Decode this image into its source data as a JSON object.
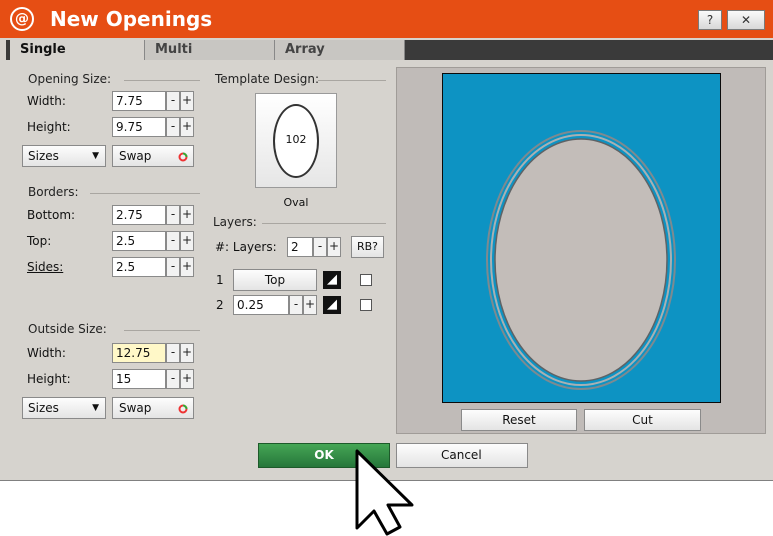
{
  "window": {
    "title": "New Openings",
    "logo_text": "@",
    "help_label": "?",
    "close_label": "✕"
  },
  "tabs": [
    "Single",
    "Multi",
    "Array"
  ],
  "opening_size": {
    "section_label": "Opening Size:",
    "width_label": "Width:",
    "width_value": "7.75",
    "height_label": "Height:",
    "height_value": "9.75",
    "sizes_label": "Sizes",
    "swap_label": "Swap"
  },
  "borders": {
    "section_label": "Borders:",
    "bottom_label": "Bottom:",
    "bottom_value": "2.75",
    "top_label": "Top:",
    "top_value": "2.5",
    "sides_label": "Sides:",
    "sides_value": "2.5"
  },
  "outside_size": {
    "section_label": "Outside Size:",
    "width_label": "Width:",
    "width_value": "12.75",
    "height_label": "Height:",
    "height_value": "15",
    "sizes_label": "Sizes",
    "swap_label": "Swap"
  },
  "template": {
    "section_label": "Template Design:",
    "number": "102",
    "name": "Oval"
  },
  "layers": {
    "section_label": "Layers:",
    "count_label": "#: Layers:",
    "count_value": "2",
    "rb_label": "RB?",
    "rows": [
      {
        "index": "1",
        "value": "Top"
      },
      {
        "index": "2",
        "value": "0.25"
      }
    ]
  },
  "stepper": {
    "minus": "-",
    "plus": "+"
  },
  "preview": {
    "reset_label": "Reset",
    "cut_label": "Cut"
  },
  "footer": {
    "ok_label": "OK",
    "cancel_label": "Cancel"
  },
  "colors": {
    "title_bar": "#e64e14",
    "mat": "#0d93c3",
    "opening": "#c3bdb9",
    "ok_button": "#2f8a3e"
  }
}
